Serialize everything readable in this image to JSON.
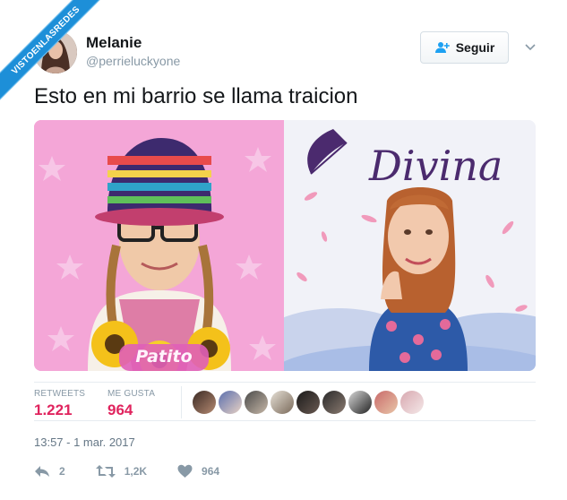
{
  "watermark": {
    "text": "VISTOENLASREDES"
  },
  "author": {
    "name": "Melanie",
    "handle": "@perrieluckyone"
  },
  "follow_button": {
    "label": "Seguir",
    "icon": "add-user-icon"
  },
  "tweet": {
    "text": "Esto en mi barrio se llama traicion"
  },
  "media": {
    "left_image": {
      "logo_text": "Patito"
    },
    "right_image": {
      "logo_text": "Divina"
    }
  },
  "stats": {
    "retweets_label": "RETWEETS",
    "retweets_value": "1.221",
    "likes_label": "ME GUSTA",
    "likes_value": "964",
    "liker_avatar_count": 9
  },
  "timestamp": "13:57 - 1 mar. 2017",
  "actions": {
    "reply_count": "2",
    "retweet_count": "1,2K",
    "like_count": "964"
  },
  "colors": {
    "accent_pink": "#e0245e",
    "muted": "#8899a6",
    "ribbon": "#1d8fd8"
  }
}
